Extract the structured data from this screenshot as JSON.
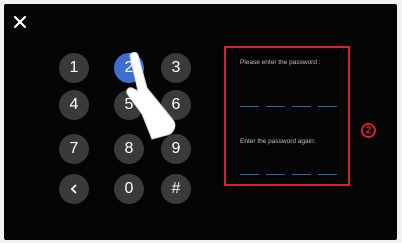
{
  "icons": {
    "close": "close-icon",
    "back": "chevron-left-icon",
    "pointer": "hand-pointer-icon"
  },
  "keypad": {
    "keys": [
      "1",
      "2",
      "3",
      "4",
      "5",
      "6",
      "7",
      "8",
      "9",
      "<",
      "0",
      "#"
    ],
    "pressed_key": "2"
  },
  "password_panel": {
    "enter_label": "Please enter the password :",
    "confirm_label": "Enter the password again:",
    "slots_per_field": 4
  },
  "step_badge": "2",
  "colors": {
    "background": "#050505",
    "key": "#3a3a3a",
    "key_pressed": "#3d6fd0",
    "highlight": "#d81f2a",
    "slot_line": "#2e63b8"
  }
}
